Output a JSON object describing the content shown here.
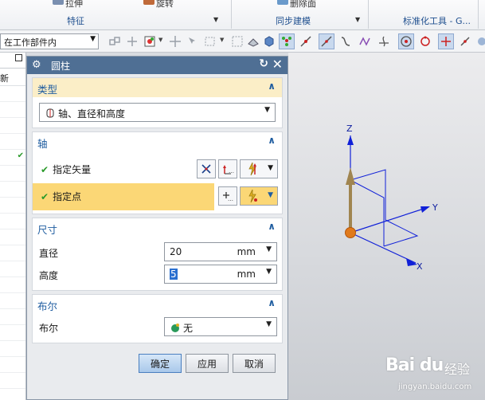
{
  "ribbon": {
    "top_labels": [
      "拉伸",
      "旋转",
      "删除面"
    ],
    "groups": [
      "特征",
      "同步建模",
      "标准化工具 - G..."
    ]
  },
  "toolbar": {
    "selection_filter": "在工作部件内"
  },
  "left_panel": {
    "column_header": "新"
  },
  "dialog": {
    "title": "圆柱",
    "sections": {
      "type": {
        "label": "类型",
        "value": "轴、直径和高度"
      },
      "axis": {
        "label": "轴",
        "specify_vector": "指定矢量",
        "specify_point": "指定点"
      },
      "dimensions": {
        "label": "尺寸",
        "diameter_label": "直径",
        "diameter_value": "20",
        "diameter_unit": "mm",
        "height_label": "高度",
        "height_value": "5",
        "height_unit": "mm"
      },
      "boolean": {
        "label": "布尔",
        "field_label": "布尔",
        "value": "无"
      }
    },
    "buttons": {
      "ok": "确定",
      "apply": "应用",
      "cancel": "取消"
    }
  },
  "viewport": {
    "axes": {
      "z": "Z",
      "y": "Y",
      "x": "X"
    },
    "colors": {
      "axis": "#1020d8",
      "vector": "#a08550",
      "origin_point": "#e07a1c"
    }
  },
  "watermark": {
    "logo": "Bai du",
    "cn": "经验",
    "url": "jingyan.baidu.com"
  }
}
